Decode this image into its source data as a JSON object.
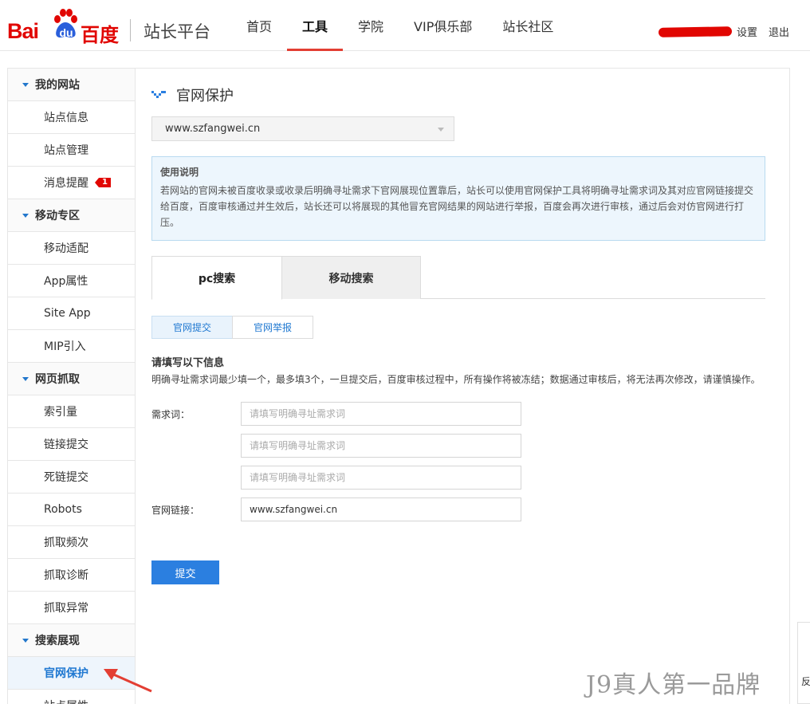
{
  "brand": {
    "logo_bai": "Bai",
    "logo_du": "du",
    "logo_cn": "百度",
    "platform": "站长平台",
    "color": "#e10602"
  },
  "nav": {
    "items": [
      {
        "label": "首页"
      },
      {
        "label": "工具"
      },
      {
        "label": "学院"
      },
      {
        "label": "VIP俱乐部"
      },
      {
        "label": "站长社区"
      }
    ],
    "active": "工具"
  },
  "userbar": {
    "settings": "设置",
    "logout": "退出"
  },
  "sidebar": {
    "groups": [
      {
        "title": "我的网站",
        "items": [
          {
            "label": "站点信息"
          },
          {
            "label": "站点管理"
          },
          {
            "label": "消息提醒",
            "badge": "1"
          }
        ]
      },
      {
        "title": "移动专区",
        "items": [
          {
            "label": "移动适配"
          },
          {
            "label": "App属性"
          },
          {
            "label": "Site App"
          },
          {
            "label": "MIP引入"
          }
        ]
      },
      {
        "title": "网页抓取",
        "items": [
          {
            "label": "索引量"
          },
          {
            "label": "链接提交"
          },
          {
            "label": "死链提交"
          },
          {
            "label": "Robots"
          },
          {
            "label": "抓取频次"
          },
          {
            "label": "抓取诊断"
          },
          {
            "label": "抓取异常"
          }
        ]
      },
      {
        "title": "搜索展现",
        "items": [
          {
            "label": "官网保护"
          },
          {
            "label": "站点属性"
          }
        ]
      }
    ],
    "active": "官网保护"
  },
  "main": {
    "title": "官网保护",
    "site_select": "www.szfangwei.cn",
    "notice": {
      "title": "使用说明",
      "body": "若网站的官网未被百度收录或收录后明确寻址需求下官网展现位置靠后，站长可以使用官网保护工具将明确寻址需求词及其对应官网链接提交给百度，百度审核通过并生效后，站长还可以将展现的其他冒充官网结果的网站进行举报，百度会再次进行审核，通过后会对仿官网进行打压。"
    },
    "tabs": [
      {
        "label": "pc搜索"
      },
      {
        "label": "移动搜索"
      }
    ],
    "subtabs": [
      {
        "label": "官网提交"
      },
      {
        "label": "官网举报"
      }
    ],
    "form": {
      "heading": "请填写以下信息",
      "desc": "明确寻址需求词最少填一个，最多填3个，一旦提交后，百度审核过程中，所有操作将被冻结；数据通过审核后，将无法再次修改，请谨慎操作。",
      "keyword_label": "需求词：",
      "keyword_placeholder": "请填写明确寻址需求词",
      "url_label": "官网链接：",
      "url_value": "www.szfangwei.cn",
      "submit": "提交"
    }
  },
  "overlay": {
    "watermark": "J9真人第一品牌",
    "float_text": "反",
    "arrow_color": "#e33e33"
  }
}
